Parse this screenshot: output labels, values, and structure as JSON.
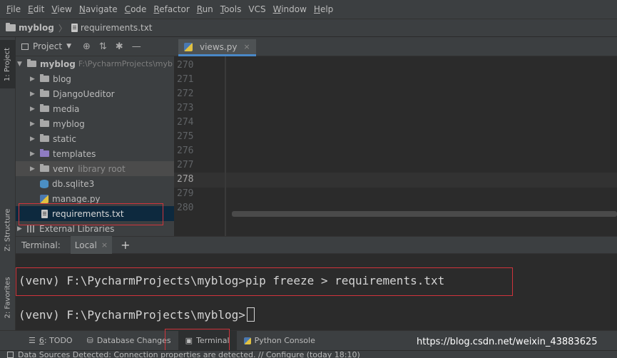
{
  "menu": [
    {
      "mnemonic": "F",
      "rest": "ile"
    },
    {
      "mnemonic": "E",
      "rest": "dit"
    },
    {
      "mnemonic": "V",
      "rest": "iew"
    },
    {
      "mnemonic": "N",
      "rest": "avigate"
    },
    {
      "mnemonic": "C",
      "rest": "ode"
    },
    {
      "mnemonic": "R",
      "rest": "efactor"
    },
    {
      "mnemonic": "R",
      "rest": "un"
    },
    {
      "mnemonic": "T",
      "rest": "ools"
    },
    {
      "mnemonic": "",
      "rest": "VCS"
    },
    {
      "mnemonic": "W",
      "rest": "indow"
    },
    {
      "mnemonic": "H",
      "rest": "elp"
    }
  ],
  "breadcrumb": {
    "project": "myblog",
    "file": "requirements.txt"
  },
  "left_stripe": {
    "project_tab": "1: Project",
    "structure_tab": "Z: Structure",
    "favorites_tab": "2: Favorites"
  },
  "project_panel": {
    "title": "Project",
    "root": {
      "name": "myblog",
      "path": "F:\\PycharmProjects\\myb"
    },
    "items": [
      {
        "label": "blog"
      },
      {
        "label": "DjangoUeditor"
      },
      {
        "label": "media"
      },
      {
        "label": "myblog"
      },
      {
        "label": "static"
      },
      {
        "label": "templates"
      },
      {
        "label": "venv",
        "hint": "library root"
      },
      {
        "label": "db.sqlite3"
      },
      {
        "label": "manage.py"
      },
      {
        "label": "requirements.txt"
      },
      {
        "label": "External Libraries"
      }
    ]
  },
  "editor": {
    "tab": "views.py",
    "line_numbers": [
      "270",
      "271",
      "272",
      "273",
      "274",
      "275",
      "276",
      "277",
      "278",
      "279",
      "280"
    ],
    "current_line": "278"
  },
  "terminal": {
    "label": "Terminal:",
    "tab": "Local",
    "add": "+",
    "lines": [
      "(venv) F:\\PycharmProjects\\myblog>pip freeze > requirements.txt",
      "(venv) F:\\PycharmProjects\\myblog>"
    ]
  },
  "bottom_tabs": {
    "todo_num": "6",
    "todo_label": ": TODO",
    "database": "Database Changes",
    "terminal": "Terminal",
    "python_console": "Python Console"
  },
  "watermark": "https://blog.csdn.net/weixin_43883625",
  "status": "Data Sources Detected: Connection properties are detected. // Configure (today 18:10)",
  "colors": {
    "accent": "#4a88c7",
    "highlight_box": "#d0343c",
    "selection": "#0d293e"
  }
}
